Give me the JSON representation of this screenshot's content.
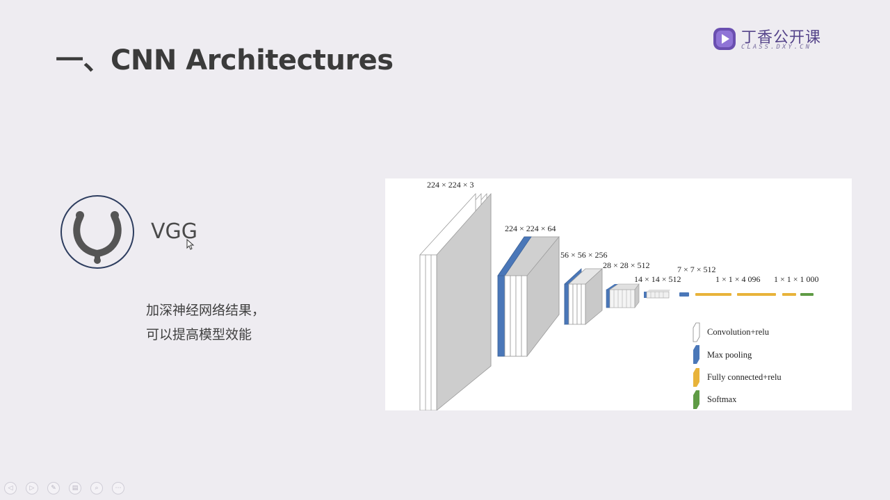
{
  "slide": {
    "title": "一、CNN Architectures",
    "vgg_label": "VGG",
    "description": [
      "加深神经网络结果，",
      "可以提高模型效能"
    ]
  },
  "logo": {
    "cn": "丁香公开课",
    "en": "CLASS.DXY.CN"
  },
  "figure": {
    "dimension_labels": [
      "224 × 224 × 3",
      "224 × 224 × 64",
      "56 × 56 × 256",
      "28 × 28 × 512",
      "14 × 14 × 512",
      "7 × 7 × 512",
      "1 × 1 × 4 096",
      "1 × 1 × 1 000"
    ],
    "legend": [
      {
        "label": "Convolution+relu",
        "color": "#ffffff"
      },
      {
        "label": "Max pooling",
        "color": "#4a77b8"
      },
      {
        "label": "Fully connected+relu",
        "color": "#e8b33a"
      },
      {
        "label": "Softmax",
        "color": "#5f9b45"
      }
    ]
  },
  "toolbar": {
    "buttons": [
      {
        "icon": "previous-icon",
        "glyph": "◁"
      },
      {
        "icon": "next-icon",
        "glyph": "▷"
      },
      {
        "icon": "pen-icon",
        "glyph": "✎"
      },
      {
        "icon": "slides-icon",
        "glyph": "▤"
      },
      {
        "icon": "zoom-icon",
        "glyph": "⌕"
      },
      {
        "icon": "more-icon",
        "glyph": "⋯"
      }
    ]
  },
  "colors": {
    "background": "#eeecf1",
    "title": "#3b3b3b",
    "logo_purple": "#55448a",
    "icon_navy": "#2d3d5f",
    "icon_gray": "#555555"
  }
}
